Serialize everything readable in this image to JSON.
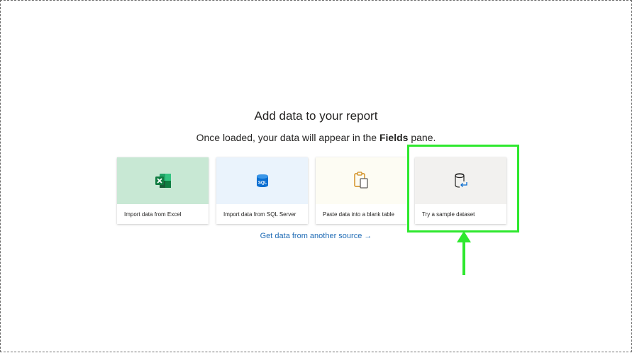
{
  "heading": {
    "title": "Add data to your report",
    "subtitle_pre": "Once loaded, your data will appear in the ",
    "subtitle_bold": "Fields",
    "subtitle_post": " pane."
  },
  "cards": [
    {
      "label": "Import data from Excel",
      "icon": "excel-icon"
    },
    {
      "label": "Import data from SQL Server",
      "icon": "sql-server-icon"
    },
    {
      "label": "Paste data into a blank table",
      "icon": "clipboard-icon"
    },
    {
      "label": "Try a sample dataset",
      "icon": "sample-dataset-icon"
    }
  ],
  "link": {
    "label": "Get data from another source →"
  },
  "colors": {
    "highlight": "#2ee82e",
    "link": "#1f6bb5",
    "excel_green": "#107c41",
    "sql_blue": "#0a6ed1"
  }
}
